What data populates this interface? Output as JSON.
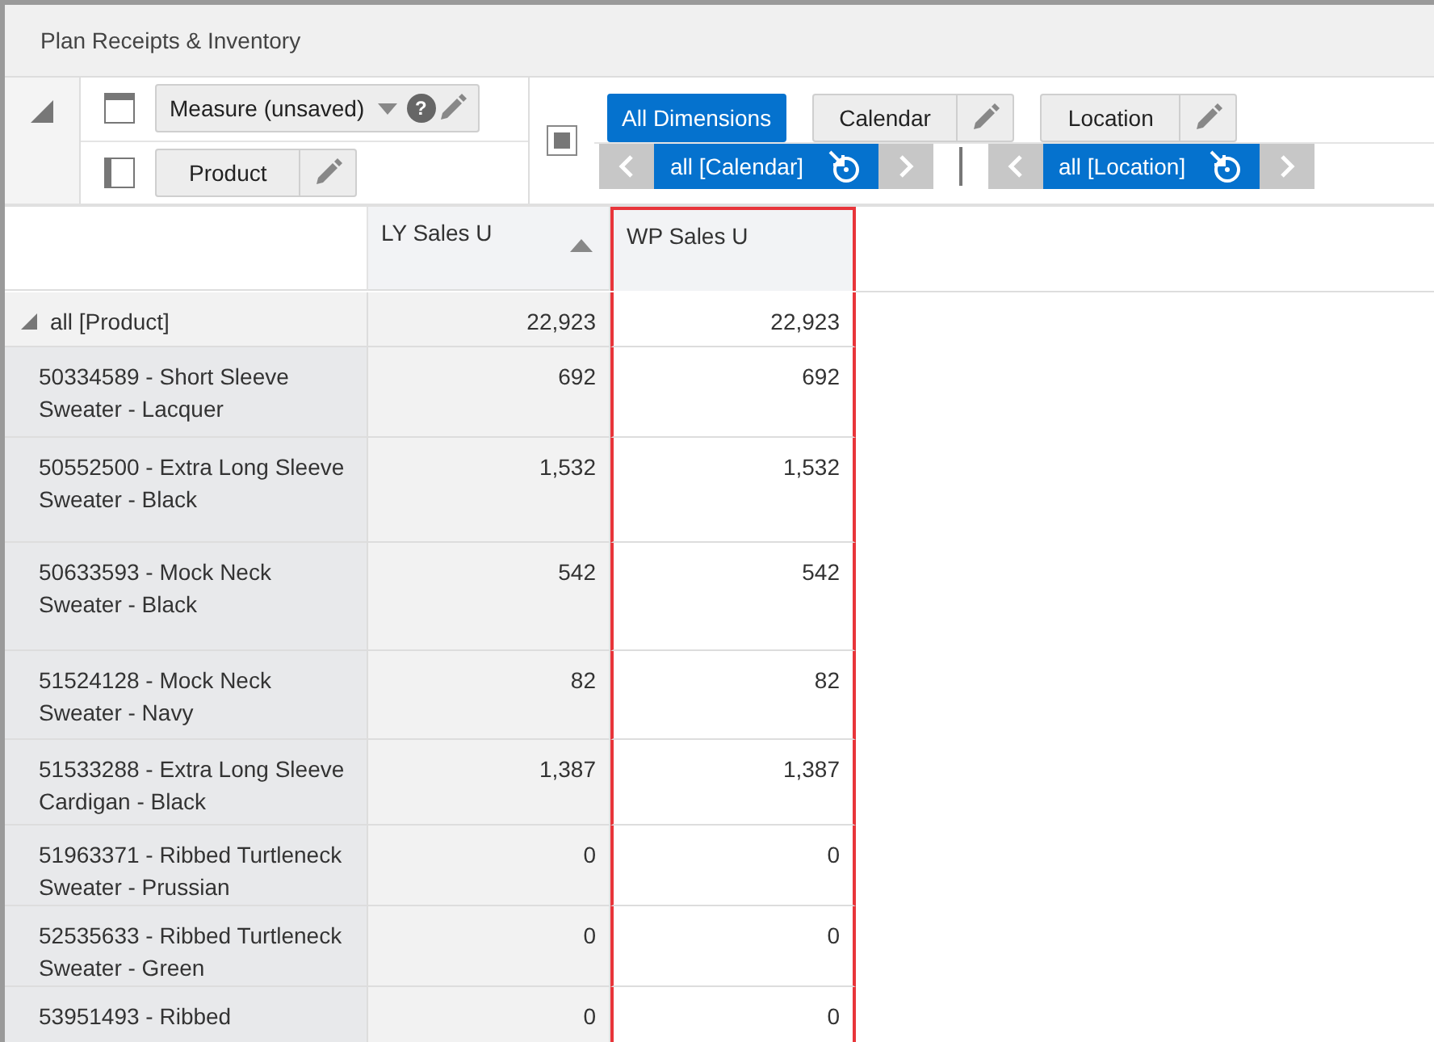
{
  "window": {
    "title": "Plan Receipts & Inventory"
  },
  "layout_toolbar": {
    "measure_dropdown": {
      "label": "Measure (unsaved)",
      "help": "?"
    },
    "product_button": {
      "label": "Product"
    }
  },
  "dimension_toolbar": {
    "buttons": [
      {
        "label": "All Dimensions",
        "selected": true,
        "editable": false
      },
      {
        "label": "Calendar",
        "selected": false,
        "editable": true
      },
      {
        "label": "Location",
        "selected": false,
        "editable": true
      }
    ],
    "navigators": [
      {
        "label": "all [Calendar]"
      },
      {
        "label": "all [Location]"
      }
    ]
  },
  "table": {
    "columns": [
      {
        "label": "LY Sales U",
        "sorted": true,
        "highlighted": false
      },
      {
        "label": "WP Sales U",
        "sorted": false,
        "highlighted": true
      }
    ],
    "total_row": {
      "label": "all [Product]",
      "expanded": true,
      "values": [
        "22,923",
        "22,923"
      ]
    },
    "rows": [
      {
        "label": "50334589 - Short Sleeve Sweater - Lacquer",
        "values": [
          "692",
          "692"
        ]
      },
      {
        "label": "50552500 - Extra Long Sleeve Sweater - Black",
        "values": [
          "1,532",
          "1,532"
        ]
      },
      {
        "label": "50633593 - Mock Neck Sweater - Black",
        "values": [
          "542",
          "542"
        ]
      },
      {
        "label": "51524128 - Mock Neck Sweater - Navy",
        "values": [
          "82",
          "82"
        ]
      },
      {
        "label": "51533288 - Extra Long Sleeve Cardigan - Black",
        "values": [
          "1,387",
          "1,387"
        ]
      },
      {
        "label": "51963371 - Ribbed Turtleneck Sweater - Prussian",
        "values": [
          "0",
          "0"
        ]
      },
      {
        "label": "52535633 - Ribbed Turtleneck Sweater - Green",
        "values": [
          "0",
          "0"
        ]
      },
      {
        "label": "53951493 - Ribbed",
        "values": [
          "0",
          "0"
        ]
      }
    ]
  }
}
